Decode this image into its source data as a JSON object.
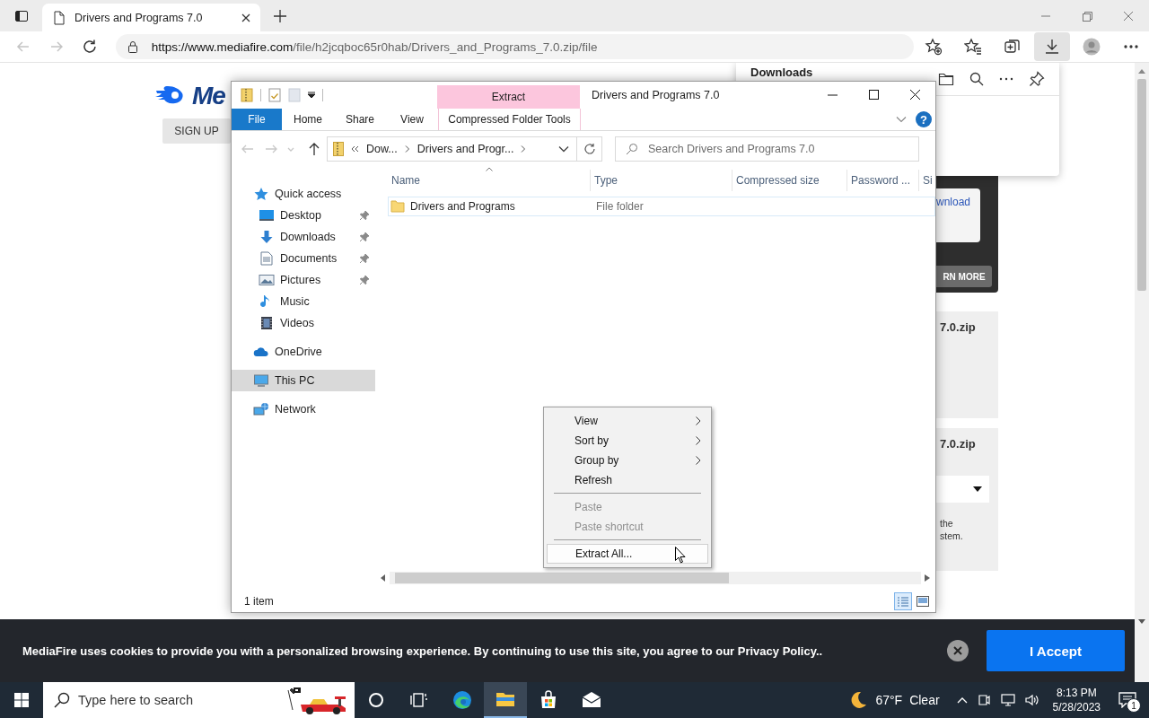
{
  "browser": {
    "tab": {
      "title": "Drivers and Programs 7.0"
    },
    "nav_buttons": [
      {
        "kind": "back",
        "disabled": true
      },
      {
        "kind": "forward",
        "disabled": true
      },
      {
        "kind": "refresh",
        "disabled": false
      }
    ],
    "url": {
      "host": "https://www.mediafire.com",
      "path": "/file/h2jcqboc65r0hab/Drivers_and_Programs_7.0.zip/file"
    },
    "toolbar": [
      {
        "kind": "add-favorite",
        "selected": false
      },
      {
        "kind": "favorites",
        "selected": false
      },
      {
        "kind": "collections",
        "selected": false
      },
      {
        "kind": "downloads",
        "selected": true
      },
      {
        "kind": "profile",
        "selected": false
      },
      {
        "kind": "more",
        "selected": false
      }
    ]
  },
  "webpage": {
    "logo_text": "Me",
    "sign_up": "SIGN UP",
    "download_button": "wnload",
    "learn_more": "RN MORE",
    "cards": [
      {
        "filename": "7.0.zip",
        "dropdown": false
      },
      {
        "filename": "7.0.zip",
        "dropdown": true,
        "note": [
          "the",
          "stem."
        ]
      }
    ]
  },
  "downloads_panel": {
    "title": "Downloads"
  },
  "explorer": {
    "title": "Drivers and Programs 7.0",
    "contextual_group": "Extract",
    "help_label": "?",
    "tabs": [
      {
        "label": "File",
        "kind": "file",
        "selected": false
      },
      {
        "label": "Home",
        "kind": "plain",
        "selected": false
      },
      {
        "label": "Share",
        "kind": "plain",
        "selected": false
      },
      {
        "label": "View",
        "kind": "plain",
        "selected": false
      },
      {
        "label": "Compressed Folder Tools",
        "kind": "contextual",
        "selected": false
      }
    ],
    "nav_buttons": [
      {
        "kind": "back",
        "disabled": true
      },
      {
        "kind": "forward",
        "disabled": true
      },
      {
        "kind": "recent",
        "disabled": true
      },
      {
        "kind": "up",
        "disabled": false
      }
    ],
    "breadcrumbs": [
      "Dow...",
      "Drivers and Progr..."
    ],
    "search": {
      "placeholder": "Search Drivers and Programs 7.0"
    },
    "nav": [
      {
        "label": "Quick access",
        "kind": "star",
        "selected": false,
        "children": [
          {
            "label": "Desktop",
            "kind": "desktop",
            "pinned": true,
            "selected": false
          },
          {
            "label": "Downloads",
            "kind": "downloads",
            "pinned": true,
            "selected": false
          },
          {
            "label": "Documents",
            "kind": "documents",
            "pinned": true,
            "selected": false
          },
          {
            "label": "Pictures",
            "kind": "pictures",
            "pinned": true,
            "selected": false
          },
          {
            "label": "Music",
            "kind": "music",
            "pinned": false,
            "selected": false
          },
          {
            "label": "Videos",
            "kind": "videos",
            "pinned": false,
            "selected": false
          }
        ]
      },
      {
        "label": "OneDrive",
        "kind": "cloud",
        "selected": false
      },
      {
        "label": "This PC",
        "kind": "pc",
        "selected": true
      },
      {
        "label": "Network",
        "kind": "network",
        "selected": false
      }
    ],
    "columns": [
      {
        "label": "Name",
        "sorted": true
      },
      {
        "label": "Type",
        "sorted": false
      },
      {
        "label": "Compressed size",
        "sorted": false
      },
      {
        "label": "Password ...",
        "sorted": false
      },
      {
        "label": "Si",
        "sorted": false
      }
    ],
    "rows": [
      {
        "name": "Drivers and Programs",
        "type": "File folder"
      }
    ],
    "status": "1 item",
    "views": [
      {
        "kind": "details",
        "selected": true
      },
      {
        "kind": "large-icons",
        "selected": false
      }
    ],
    "context_menu": [
      {
        "label": "View",
        "kind": "submenu",
        "disabled": false,
        "selected": false
      },
      {
        "label": "Sort by",
        "kind": "submenu",
        "disabled": false,
        "selected": false
      },
      {
        "label": "Group by",
        "kind": "submenu",
        "disabled": false,
        "selected": false
      },
      {
        "label": "Refresh",
        "kind": "command",
        "disabled": false,
        "selected": false
      },
      {
        "kind": "separator"
      },
      {
        "label": "Paste",
        "kind": "command",
        "disabled": true,
        "selected": false
      },
      {
        "label": "Paste shortcut",
        "kind": "command",
        "disabled": true,
        "selected": false
      },
      {
        "kind": "separator"
      },
      {
        "label": "Extract All...",
        "kind": "command",
        "disabled": false,
        "selected": true
      }
    ]
  },
  "cookie_banner": {
    "text": "MediaFire uses cookies to provide you with a personalized browsing experience. By continuing to use this site, you agree to our Privacy Policy..",
    "accept": "I Accept"
  },
  "taskbar": {
    "search_placeholder": "Type here to search",
    "apps": [
      {
        "kind": "cortana",
        "active": false
      },
      {
        "kind": "task-view",
        "active": false
      },
      {
        "kind": "edge",
        "active": false
      },
      {
        "kind": "file-explorer",
        "active": true
      },
      {
        "kind": "store",
        "active": false
      },
      {
        "kind": "mail",
        "active": false
      }
    ],
    "weather": {
      "temperature": "67°F",
      "condition": "Clear"
    },
    "time": "8:13 PM",
    "date": "5/28/2023",
    "notification_count": "1"
  }
}
